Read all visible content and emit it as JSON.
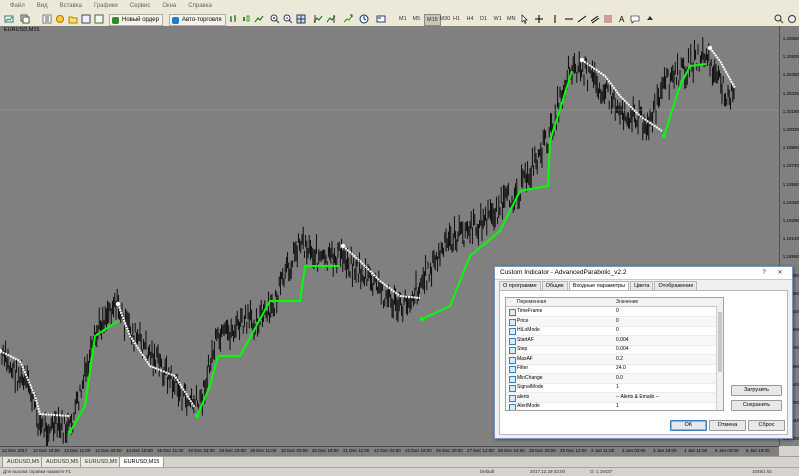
{
  "menu": [
    "Файл",
    "Вид",
    "Вставка",
    "Графики",
    "Сервис",
    "Окна",
    "Справка"
  ],
  "toolbar": {
    "new_order": "Новый ордер",
    "auto_trading": "Авто-торговля",
    "timeframes": [
      "M1",
      "M5",
      "M15",
      "M30",
      "H1",
      "H4",
      "D1",
      "W1",
      "MN"
    ],
    "active_timeframe": "M15"
  },
  "chart": {
    "title": "EURUSD,M15",
    "background": "#808080",
    "candle_color": "#000000",
    "up_trend_color": "#00ff00",
    "down_trend_color": "#ffffff",
    "price_labels": [
      "1.20880",
      "1.20830",
      "1.20480",
      "1.20330",
      "1.20180",
      "1.20030",
      "1.19890",
      "1.19740",
      "1.19590",
      "1.19440",
      "1.19290",
      "1.19140",
      "1.18990",
      "1.18840",
      "1.18690",
      "1.18540",
      "1.18390",
      "1.18240",
      "1.18090",
      "1.17940",
      "1.17790",
      "1.17640",
      "1.17490"
    ],
    "time_labels": [
      "12 Dec 2017",
      "12 Dec 19:00",
      "13 Dec 11:00",
      "14 Dec 03:00",
      "14 Dec 19:00",
      "15 Dec 11:00",
      "18 Dec 03:00",
      "18 Dec 19:00",
      "19 Dec 11:00",
      "20 Dec 03:00",
      "20 Dec 19:00",
      "21 Dec 11:00",
      "22 Dec 03:00",
      "22 Dec 19:00",
      "26 Dec 20:00",
      "27 Dec 12:00",
      "28 Dec 04:00",
      "28 Dec 20:00",
      "29 Dec 12:00",
      "2 Jan 11:00",
      "3 Jan 03:00",
      "3 Jan 19:00",
      "4 Jan 11:00",
      "5 Jan 03:00",
      "5 Jan 19:00"
    ]
  },
  "tabs": [
    "AUDUSD,M5",
    "AUDUSD,M5",
    "EURUSD,M5",
    "EURUSD,M15"
  ],
  "active_tab": "EURUSD,M15",
  "status": {
    "help": "Для вызова справки нажмите F1",
    "profile": "Default",
    "datetime": "2017.12.29 03:00",
    "open": "O: 1.19437",
    "kb": "1049/1 kb"
  },
  "dialog": {
    "title": "Custom Indicator - AdvancedParabolic_v2.2",
    "help_btn": "?",
    "close_btn": "✕",
    "tabs": [
      "О программе",
      "Общие",
      "Входные параметры",
      "Цвета",
      "Отображение"
    ],
    "active_tab": "Входные параметры",
    "col_variable": "Переменная",
    "col_value": "Значение",
    "params": [
      {
        "name": "TimeFrame",
        "value": "0"
      },
      {
        "name": "Price",
        "value": "0"
      },
      {
        "name": "HiLoMode",
        "value": "0"
      },
      {
        "name": "StartAF",
        "value": "0.004"
      },
      {
        "name": "Step",
        "value": "0.004"
      },
      {
        "name": "MaxAF",
        "value": "0.2"
      },
      {
        "name": "Filter",
        "value": "24.0"
      },
      {
        "name": "MinChange",
        "value": "0.0"
      },
      {
        "name": "SignalMode",
        "value": "1"
      },
      {
        "name": "alerts",
        "value": "-- Alerts & Emails --"
      },
      {
        "name": "AlertMode",
        "value": "1"
      }
    ],
    "load_btn": "Загрузить",
    "save_btn": "Сохранить",
    "ok_btn": "OK",
    "cancel_btn": "Отмена",
    "reset_btn": "Сброс"
  }
}
